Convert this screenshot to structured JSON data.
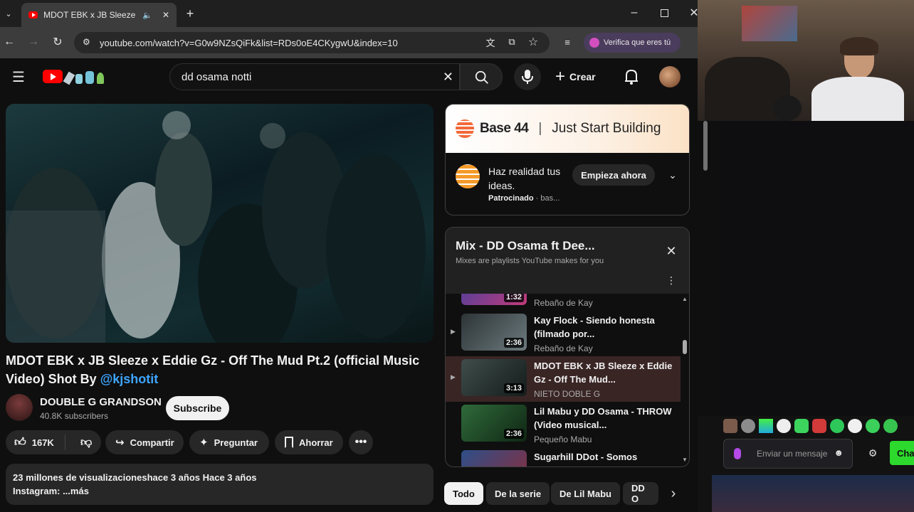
{
  "browser": {
    "tab_title": "MDOT EBK x JB Sleeze x Ed",
    "url": "youtube.com/watch?v=G0w9NZsQiFk&list=RDs0oE4CKygwU&index=10",
    "verify_label": "Verifica que eres tú"
  },
  "youtube": {
    "search_value": "dd osama notti",
    "create_label": "Crear"
  },
  "video": {
    "title_main": "MDOT EBK x JB Sleeze x Eddie Gz - Off The Mud Pt.2 (official Music Video) Shot By ",
    "title_link": "@kjshotit",
    "channel_name": "DOUBLE G GRANDSON",
    "subscribers": "40.8K subscribers",
    "subscribe_label": "Subscribe",
    "likes": "167K",
    "share_label": "Compartir",
    "ask_label": "Preguntar",
    "save_label": "Ahorrar",
    "desc_line1": "23 millones de visualizacioneshace 3 años  Hace 3 años",
    "desc_line2": "Instagram: ...más"
  },
  "ad": {
    "brand": "Base 44",
    "tagline": "Just Start Building",
    "headline": "Haz realidad tus ideas.",
    "sponsored": "Patrocinado",
    "sponsor_suffix": " · bas...",
    "cta": "Empieza ahora"
  },
  "mix": {
    "title": "Mix - DD Osama ft Dee...",
    "subtitle": "Mixes are playlists YouTube makes for you",
    "items": [
      {
        "title": "",
        "artist": "Rebaño de Kay",
        "duration": "1:32"
      },
      {
        "title": "Kay Flock - Siendo honesta (filmado por...",
        "artist": "Rebaño de Kay",
        "duration": "2:36"
      },
      {
        "title": "MDOT EBK x JB Sleeze x Eddie Gz - Off The Mud...",
        "artist": "NIETO DOBLE G",
        "duration": "3:13"
      },
      {
        "title": "Lil Mabu y DD Osama - THROW (Video musical...",
        "artist": "Pequeño Mabu",
        "duration": "2:36"
      },
      {
        "title": "Sugarhill DDot - Somos",
        "artist": "",
        "duration": ""
      }
    ]
  },
  "chips": [
    "Todo",
    "De la serie",
    "De Lil Mabu",
    "DD O"
  ],
  "stream": {
    "chat_placeholder": "Enviar un mensaje",
    "chat_button": "Cha"
  },
  "colors": {
    "yt_red": "#ff0000",
    "link_blue": "#3ea6ff",
    "chat_green": "#2cd92c"
  }
}
